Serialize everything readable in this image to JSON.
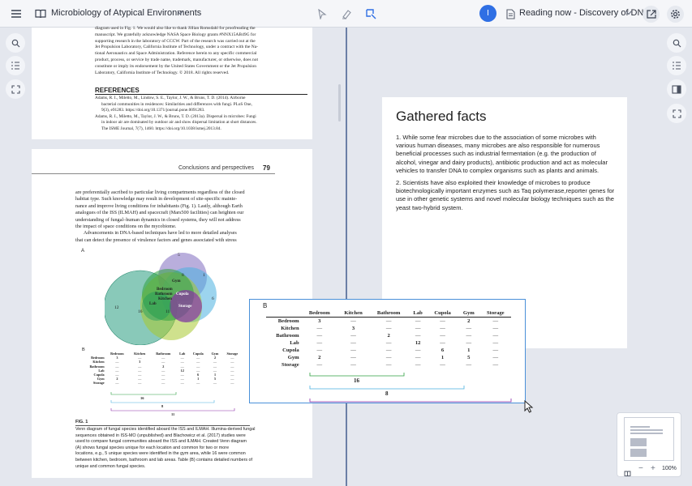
{
  "topbar": {
    "doc_title": "Microbiology of Atypical Environments",
    "reading_now": "Reading now - Discovery of DNA",
    "avatar_letter": "I"
  },
  "page1": {
    "ack": [
      "diagram used in Fig. 1. We would also like to thank Jillian Romsdahl for proofreading the",
      "manuscript. We gratefully acknowledge NASA Space Biology grants #NNX15AB49G for",
      "supporting research in the laboratory of CCCW. Part of the research was carried out at the",
      "Jet Propulsion Laboratory, California Institute of Technology, under a contract with the Na-",
      "tional Aeronautics and Space Administration. Reference herein to any specific commercial",
      "product, process, or service by trade name, trademark, manufacturer, or otherwise, does not",
      "constitute or imply its endorsement by the United States Government or the Jet Propulsion",
      "Laboratory, California Institute of Technology. © 2018. All rights reserved."
    ],
    "ref_heading": "REFERENCES",
    "refs": [
      "Adams, R. I., Miletto, M., Lindow, S. E., Taylor, J. W., & Bruns, T. D. (2014). Airborne",
      "bacterial communities in residences: Similarities and differences with fungi. PLoS One,",
      "9(3), e91283. https://doi.org/10.1371/journal.pone.0091283.",
      "Adams, R. I., Miletto, M., Taylor, J. W., & Bruns, T. D. (2013a). Dispersal in microbes: Fungi",
      "in indoor air are dominated by outdoor air and show dispersal limitation at short distances.",
      "The ISME Journal, 7(7), 1460. https://doi.org/10.1038/ismej.2013.84."
    ]
  },
  "page2": {
    "running_head": "Conclusions and perspectives",
    "page_number": "79",
    "body": [
      "are preferentially ascribed to particular living compartments regardless of the closed",
      "habitat type. Such knowledge may result in development of site-specific mainte-",
      "nance and improve living conditions for inhabitants (Fig. 1). Lastly, although Earth",
      "analogues of the ISS (ILMAH) and spacecraft (Mars500 facilities) can heighten our",
      "understanding of fungal–human dynamics in closed systems, they will not address",
      "the impact of space conditions on the mycobiome.",
      "Advancements in DNA-based techniques have led to more detailed analyses",
      "that can detect the presence of virulence factors and genes associated with stress"
    ],
    "fig_label_a": "A",
    "fig_label_b": "B",
    "venn": {
      "n5": "5",
      "n8": "8",
      "n1": "1",
      "n6": "6",
      "n12": "12",
      "n16": "16",
      "n11": "11",
      "gym": "Gym",
      "bedroom": "Bedroom",
      "bathroom": "Bathroom",
      "kitchen": "Kitchen",
      "cupola": "Cupola",
      "lab": "Lab",
      "storage": "Storage"
    },
    "fig_num": "FIG. 1",
    "caption": [
      "Venn diagram of fungal species identified aboard the ISS and ILMAH. Illumina-derived fungal",
      "sequences obtained in ISS-MO (unpublished) and Blachowicz et al. (2017) studies were",
      "used to compare fungal communities aboard the ISS and ILMAH. Created Venn diagram",
      "(A) shows fungal species unique for each location and common for two or more",
      "locations, e.g., 5 unique species were identified in the gym area, while 16 were common",
      "between kitchen, bedroom, bathroom and lab areas. Table (B) contains detailed numbers of",
      "unique and common fungal species."
    ]
  },
  "table": {
    "headers": [
      "Bedroom",
      "Kitchen",
      "Bathroom",
      "Lab",
      "Cupola",
      "Gym",
      "Storage"
    ],
    "rows": [
      {
        "label": "Bedroom",
        "cells": [
          "3",
          "—",
          "—",
          "—",
          "—",
          "2",
          "—"
        ]
      },
      {
        "label": "Kitchen",
        "cells": [
          "—",
          "3",
          "—",
          "—",
          "—",
          "—",
          "—"
        ]
      },
      {
        "label": "Bathroom",
        "cells": [
          "—",
          "—",
          "2",
          "—",
          "—",
          "—",
          "—"
        ]
      },
      {
        "label": "Lab",
        "cells": [
          "—",
          "—",
          "—",
          "12",
          "—",
          "—",
          "—"
        ]
      },
      {
        "label": "Cupola",
        "cells": [
          "—",
          "—",
          "—",
          "—",
          "6",
          "1",
          "—"
        ]
      },
      {
        "label": "Gym",
        "cells": [
          "2",
          "—",
          "—",
          "—",
          "1",
          "5",
          "—"
        ]
      },
      {
        "label": "Storage",
        "cells": [
          "—",
          "—",
          "—",
          "—",
          "—",
          "—",
          "—"
        ]
      }
    ],
    "brackets": [
      "16",
      "8",
      "11"
    ],
    "popup_label": "B",
    "popup_brackets": [
      "16",
      "8"
    ]
  },
  "notes": {
    "title": "Gathered facts",
    "facts": [
      "1. While some fear microbes due to the association of some microbes with various human diseases, many microbes are also responsible for numerous beneficial processes such as industrial fermentation (e.g. the production of alcohol, vinegar and dairy products), antibiotic production and act as molecular vehicles to transfer DNA to complex organisms such as plants and animals.",
      "2. Scientists have also exploited their knowledge of microbes to produce biotechnologically important enzymes such as Taq polymerase,reporter genes for use in other genetic systems and novel molecular biology techniques such as the yeast two-hybrid system."
    ]
  },
  "zoom": {
    "level": "100%"
  },
  "colors": {
    "accent": "#2f6fe4",
    "divider": "#6b7fa6"
  }
}
